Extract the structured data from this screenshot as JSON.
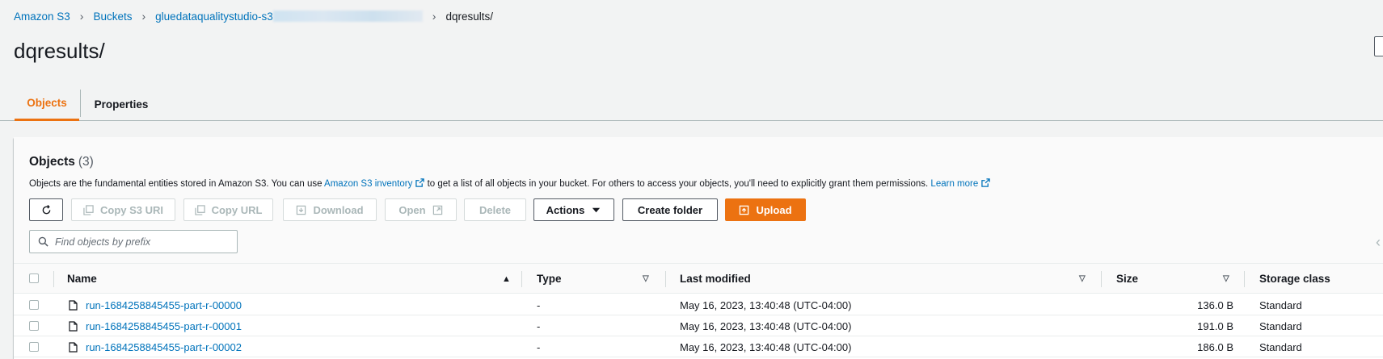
{
  "breadcrumb": {
    "items": [
      "Amazon S3",
      "Buckets",
      "gluedataqualitystudio-s3",
      "dqresults/"
    ]
  },
  "page_title": "dqresults/",
  "tabs": [
    {
      "label": "Objects",
      "active": true
    },
    {
      "label": "Properties",
      "active": false
    }
  ],
  "objects_panel": {
    "title": "Objects",
    "count": "(3)",
    "description_prefix": "Objects are the fundamental entities stored in Amazon S3. You can use",
    "inventory_link": "Amazon S3 inventory",
    "description_suffix": "to get a list of all objects in your bucket. For others to access your objects, you'll need to explicitly grant them permissions.",
    "learn_more": "Learn more"
  },
  "toolbar": {
    "copy_s3_uri": "Copy S3 URI",
    "copy_url": "Copy URL",
    "download": "Download",
    "open": "Open",
    "delete": "Delete",
    "actions": "Actions",
    "create_folder": "Create folder",
    "upload": "Upload"
  },
  "search": {
    "placeholder": "Find objects by prefix"
  },
  "table": {
    "columns": [
      "Name",
      "Type",
      "Last modified",
      "Size",
      "Storage class"
    ],
    "rows": [
      {
        "name": "run-1684258845455-part-r-00000",
        "type": "-",
        "last_modified": "May 16, 2023, 13:40:48 (UTC-04:00)",
        "size": "136.0 B",
        "storage_class": "Standard"
      },
      {
        "name": "run-1684258845455-part-r-00001",
        "type": "-",
        "last_modified": "May 16, 2023, 13:40:48 (UTC-04:00)",
        "size": "191.0 B",
        "storage_class": "Standard"
      },
      {
        "name": "run-1684258845455-part-r-00002",
        "type": "-",
        "last_modified": "May 16, 2023, 13:40:48 (UTC-04:00)",
        "size": "186.0 B",
        "storage_class": "Standard"
      }
    ]
  },
  "colors": {
    "accent": "#ec7211",
    "link": "#0073bb",
    "text": "#16191f",
    "background": "#f2f3f3"
  },
  "icons": [
    "refresh-icon",
    "copy-icon",
    "download-icon",
    "external-link-icon",
    "caret-down-icon",
    "upload-icon",
    "search-icon",
    "file-icon",
    "sort-ascending-icon",
    "sort-descending-icon"
  ]
}
